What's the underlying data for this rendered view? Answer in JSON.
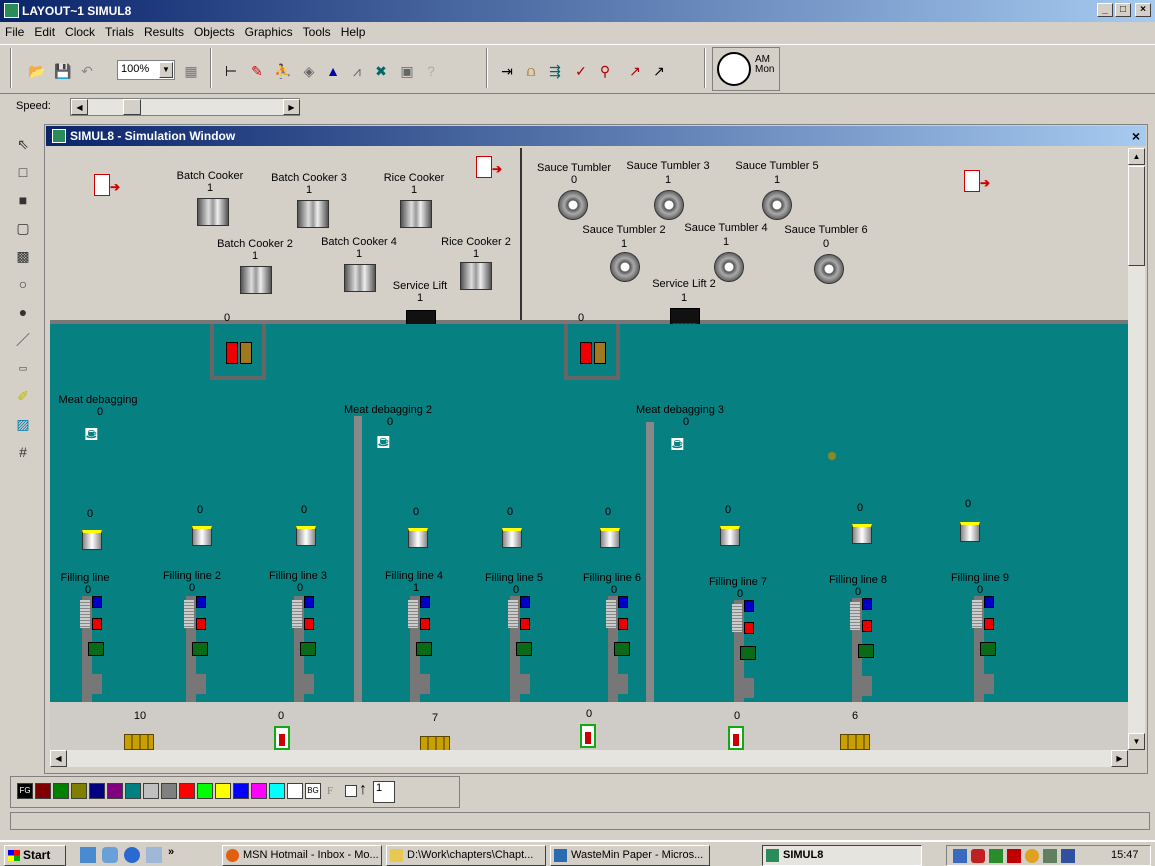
{
  "app": {
    "title": "LAYOUT~1  SIMUL8",
    "win_buttons": [
      "_",
      "□",
      "×"
    ]
  },
  "menu": [
    "File",
    "Edit",
    "Clock",
    "Trials",
    "Results",
    "Objects",
    "Graphics",
    "Tools",
    "Help"
  ],
  "toolbar": {
    "zoom": "100%",
    "clock_ampm": "AM",
    "clock_day": "Mon",
    "speed_label": "Speed:"
  },
  "sim_window": {
    "title": "SIMUL8 - Simulation Window",
    "close": "×"
  },
  "cookers": [
    {
      "name": "Batch Cooker",
      "count": "1"
    },
    {
      "name": "Batch Cooker 3",
      "count": "1"
    },
    {
      "name": "Rice Cooker",
      "count": "1"
    },
    {
      "name": "Batch Cooker 2",
      "count": "1"
    },
    {
      "name": "Batch Cooker 4",
      "count": "1"
    },
    {
      "name": "Rice Cooker 2",
      "count": "1"
    }
  ],
  "tumblers": [
    {
      "name": "Sauce Tumbler",
      "count": "0"
    },
    {
      "name": "Sauce Tumbler 3",
      "count": "1"
    },
    {
      "name": "Sauce Tumbler 5",
      "count": "1"
    },
    {
      "name": "Sauce Tumbler 2",
      "count": "1"
    },
    {
      "name": "Sauce Tumbler 4",
      "count": "1"
    },
    {
      "name": "Sauce Tumbler 6",
      "count": "0"
    }
  ],
  "lifts": [
    {
      "name": "Service Lift",
      "count": "1"
    },
    {
      "name": "Service Lift 2",
      "count": "1"
    }
  ],
  "hoppers": [
    {
      "count": "0"
    },
    {
      "count": "0"
    }
  ],
  "debagging": [
    {
      "name": "Meat debagging",
      "count": "0"
    },
    {
      "name": "Meat debagging 2",
      "count": "0"
    },
    {
      "name": "Meat debagging 3",
      "count": "0"
    }
  ],
  "bins": [
    "0",
    "0",
    "0",
    "0",
    "0",
    "0",
    "0",
    "0",
    "0"
  ],
  "filling_lines": [
    {
      "name": "Filling line",
      "count": "0"
    },
    {
      "name": "Filling line 2",
      "count": "0"
    },
    {
      "name": "Filling line 3",
      "count": "0"
    },
    {
      "name": "Filling line 4",
      "count": "1"
    },
    {
      "name": "Filling line 5",
      "count": "0"
    },
    {
      "name": "Filling line 6",
      "count": "0"
    },
    {
      "name": "Filling line 7",
      "count": "0"
    },
    {
      "name": "Filling line 8",
      "count": "0"
    },
    {
      "name": "Filling line 9",
      "count": "0"
    }
  ],
  "outputs": [
    "10",
    "0",
    "7",
    "0",
    "0",
    "6"
  ],
  "colorbar": {
    "fg": "FG",
    "bg": "BG",
    "f": "F",
    "colors": [
      "#800000",
      "#008000",
      "#808000",
      "#000080",
      "#800080",
      "#008080",
      "#c0c0c0",
      "#808080",
      "#ff0000",
      "#00ff00",
      "#ffff00",
      "#0000ff",
      "#ff00ff",
      "#00ffff",
      "#ffffff"
    ],
    "spin_value": "1"
  },
  "taskbar": {
    "start": "Start",
    "tasks": [
      "MSN Hotmail - Inbox - Mo...",
      "D:\\Work\\chapters\\Chapt...",
      "WasteMin Paper - Micros...",
      "SIMUL8"
    ],
    "time": "15:47",
    "chevron": "»"
  }
}
